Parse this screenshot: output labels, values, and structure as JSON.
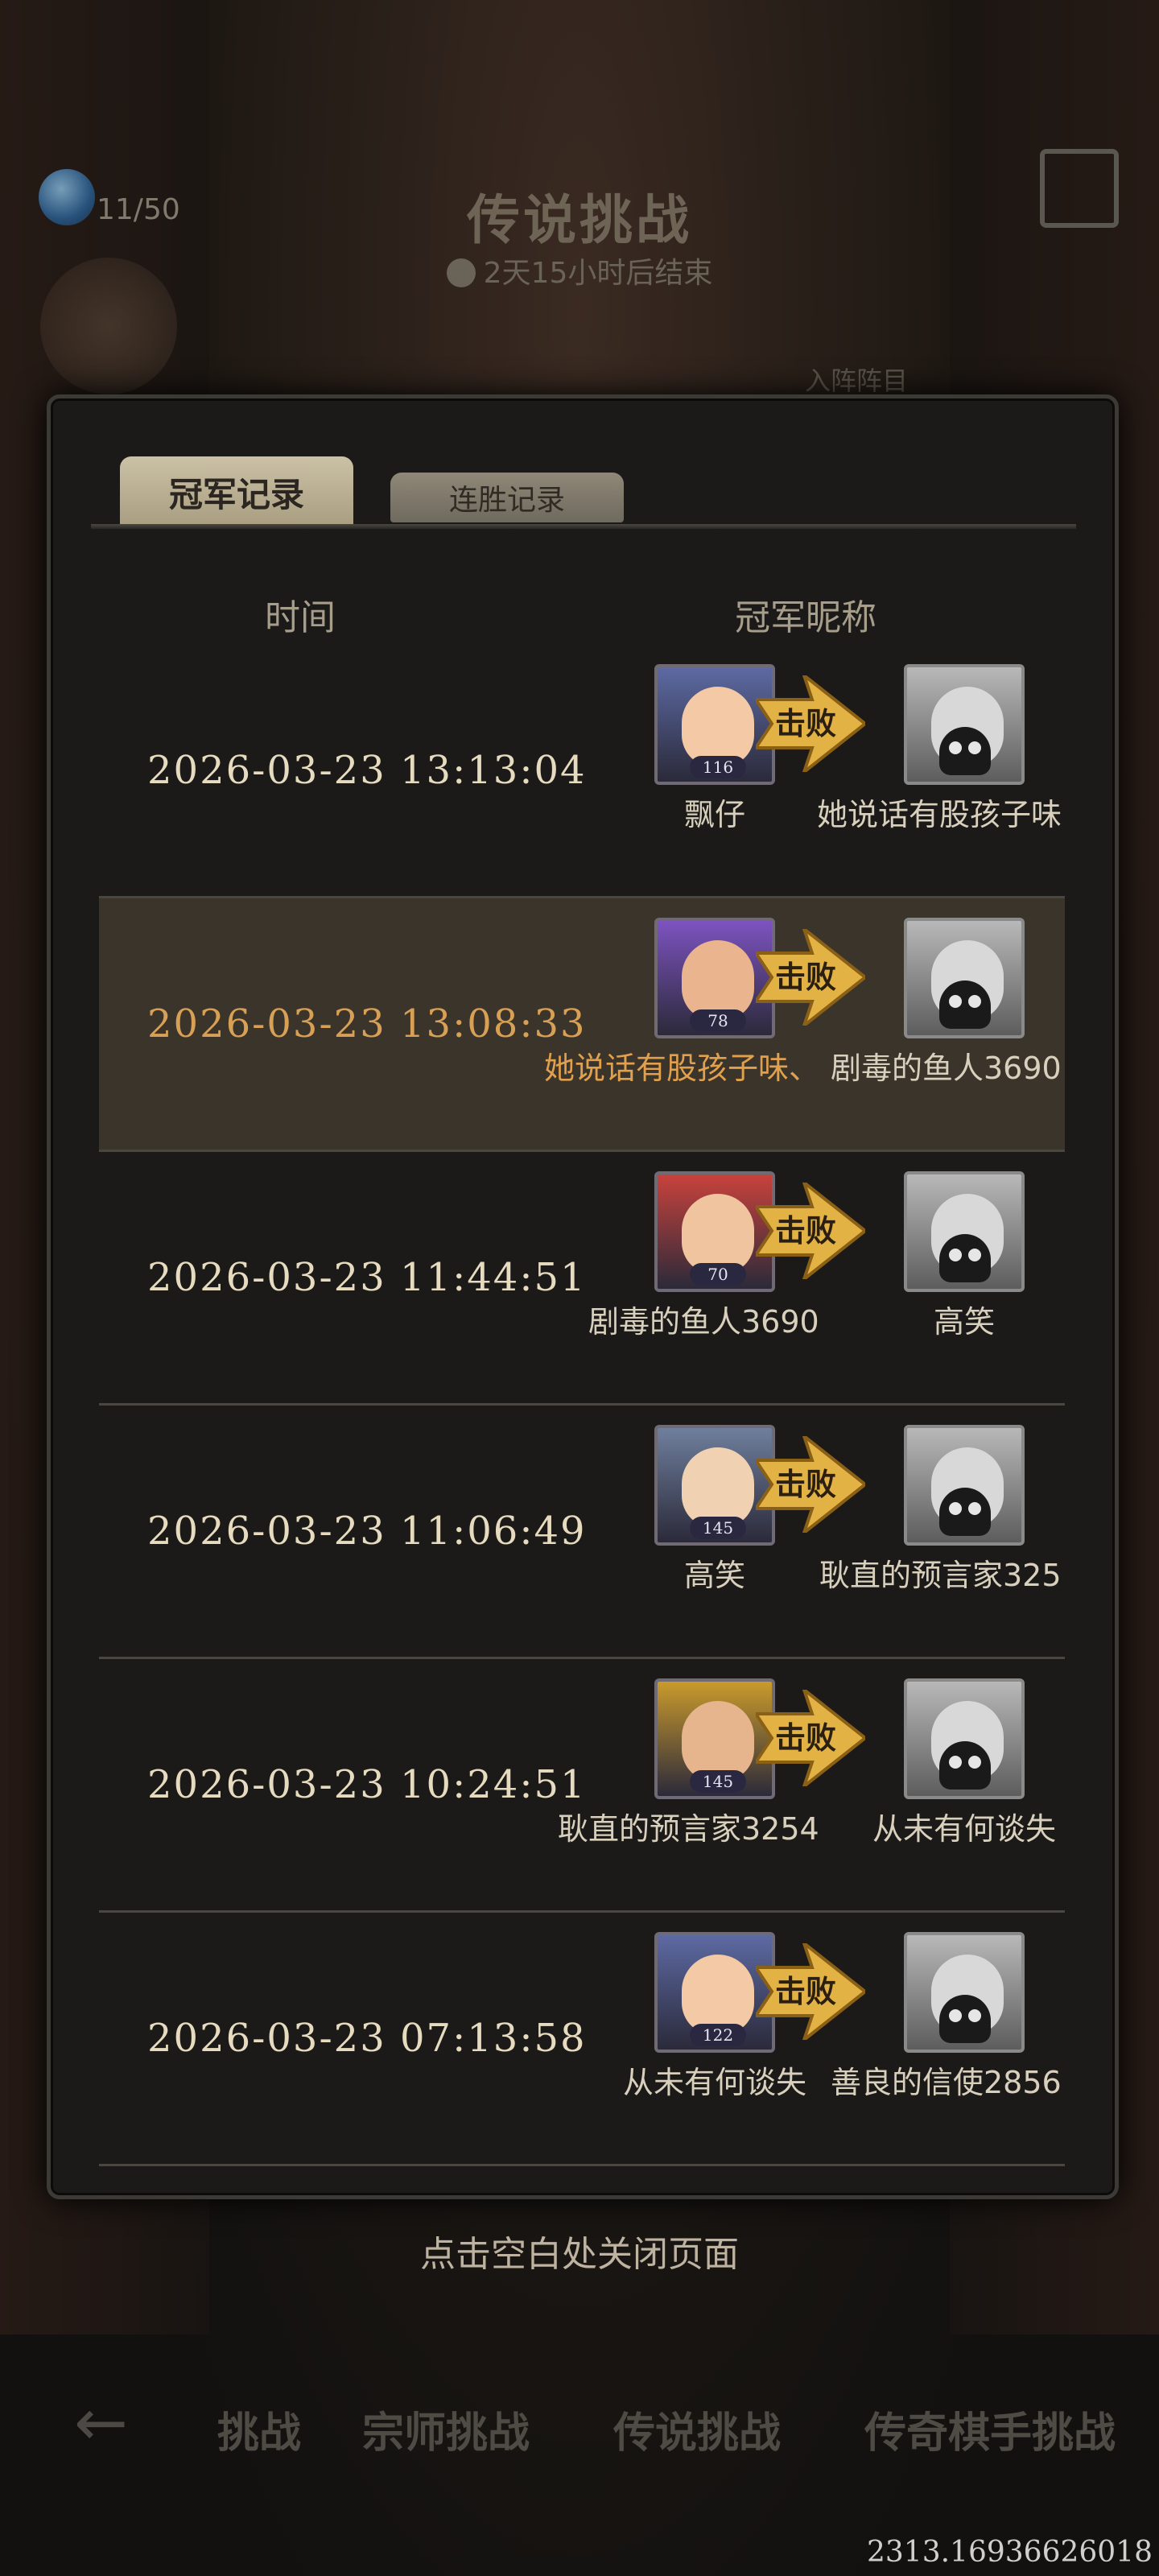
{
  "hud": {
    "resource_count": "11/50",
    "title": "传说挑战",
    "timer": "2天15小时后结束",
    "sub_label": "入阵阵目"
  },
  "tabs": [
    {
      "label": "冠军记录",
      "active": true
    },
    {
      "label": "连胜记录",
      "active": false
    }
  ],
  "columns": {
    "time": "时间",
    "champion": "冠军昵称"
  },
  "records": [
    {
      "time": "2026-03-23 13:13:04",
      "winner": "飘仔",
      "winner_level": "116",
      "action": "击败",
      "loser": "她说话有股孩子味",
      "highlight": false
    },
    {
      "time": "2026-03-23 13:08:33",
      "winner": "她说话有股孩子味、",
      "winner_level": "78",
      "action": "击败",
      "loser": "剧毒的鱼人3690",
      "highlight": true
    },
    {
      "time": "2026-03-23 11:44:51",
      "winner": "剧毒的鱼人3690",
      "winner_level": "70",
      "action": "击败",
      "loser": "高笑",
      "highlight": false
    },
    {
      "time": "2026-03-23 11:06:49",
      "winner": "高笑",
      "winner_level": "145",
      "action": "击败",
      "loser": "耿直的预言家325",
      "highlight": false
    },
    {
      "time": "2026-03-23 10:24:51",
      "winner": "耿直的预言家3254",
      "winner_level": "145",
      "action": "击败",
      "loser": "从未有何谈失",
      "highlight": false
    },
    {
      "time": "2026-03-23 07:13:58",
      "winner": "从未有何谈失",
      "winner_level": "122",
      "action": "击败",
      "loser": "善良的信使2856",
      "highlight": false
    }
  ],
  "footer_hint": "点击空白处关闭页面",
  "bottom_nav": [
    "挑战",
    "宗师挑战",
    "传说挑战",
    "传奇棋手挑战"
  ],
  "coordinates": "2313.16936626018",
  "colors": {
    "accent": "#d7a055",
    "panel": "#1b1a18",
    "tab_active": "#cbc1a6"
  }
}
